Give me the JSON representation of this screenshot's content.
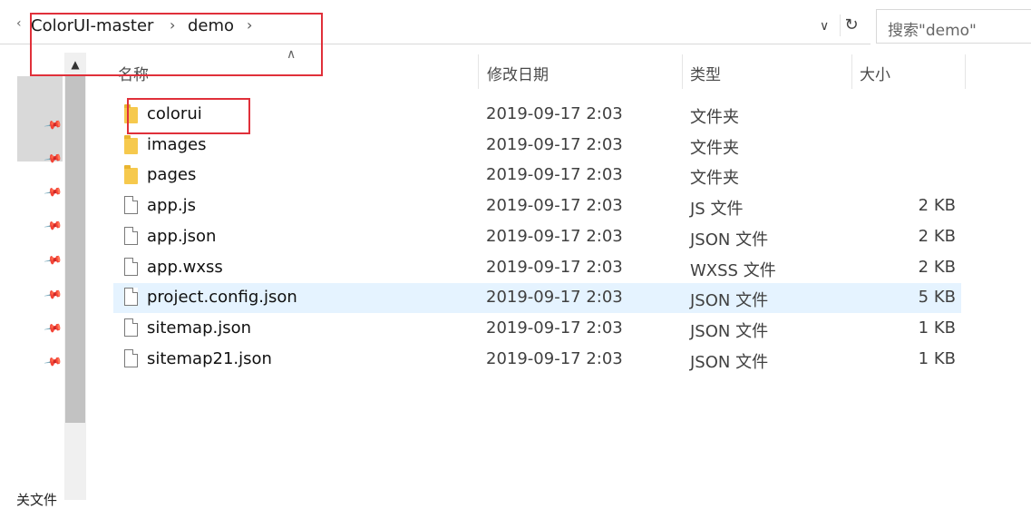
{
  "address_bar": {
    "prev_glyph": "‹",
    "breadcrumb": [
      {
        "label": "ColorUI-master"
      },
      {
        "label": "demo"
      }
    ],
    "separator": "›",
    "dropdown_glyph": "∨",
    "refresh_glyph": "↻"
  },
  "search": {
    "placeholder": "搜索\"demo\""
  },
  "nav_pane": {
    "scroll_up_glyph": "▲",
    "pin_glyph": "📌",
    "bottom_label": "关文件"
  },
  "columns": {
    "name": "名称",
    "date": "修改日期",
    "type": "类型",
    "size": "大小",
    "sort_glyph": "∧"
  },
  "files": [
    {
      "name": "colorui",
      "date": "2019-09-17 2:03",
      "type": "文件夹",
      "size": "",
      "icon": "folder-icon"
    },
    {
      "name": "images",
      "date": "2019-09-17 2:03",
      "type": "文件夹",
      "size": "",
      "icon": "folder-icon"
    },
    {
      "name": "pages",
      "date": "2019-09-17 2:03",
      "type": "文件夹",
      "size": "",
      "icon": "folder-icon"
    },
    {
      "name": "app.js",
      "date": "2019-09-17 2:03",
      "type": "JS 文件",
      "size": "2 KB",
      "icon": "file-icon"
    },
    {
      "name": "app.json",
      "date": "2019-09-17 2:03",
      "type": "JSON 文件",
      "size": "2 KB",
      "icon": "file-icon"
    },
    {
      "name": "app.wxss",
      "date": "2019-09-17 2:03",
      "type": "WXSS 文件",
      "size": "2 KB",
      "icon": "file-icon"
    },
    {
      "name": "project.config.json",
      "date": "2019-09-17 2:03",
      "type": "JSON 文件",
      "size": "5 KB",
      "icon": "file-icon",
      "selected": true
    },
    {
      "name": "sitemap.json",
      "date": "2019-09-17 2:03",
      "type": "JSON 文件",
      "size": "1 KB",
      "icon": "file-icon"
    },
    {
      "name": "sitemap21.json",
      "date": "2019-09-17 2:03",
      "type": "JSON 文件",
      "size": "1 KB",
      "icon": "file-icon"
    }
  ],
  "colors": {
    "selection": "#e5f3ff",
    "annotation_red": "#e0303a",
    "folder": "#f6c94d"
  }
}
